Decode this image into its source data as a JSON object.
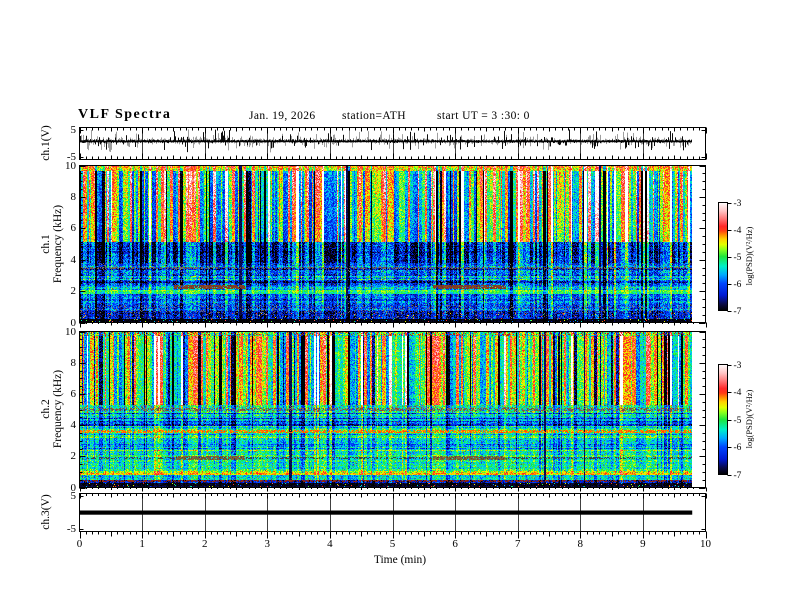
{
  "header": {
    "title": "VLF  Spectra",
    "date": "Jan. 19, 2026",
    "station": "station=ATH",
    "start_ut": "start UT =  3 :30: 0"
  },
  "axes": {
    "x": {
      "label": "Time  (min)",
      "min": 0,
      "max": 10,
      "major_ticks": [
        0,
        1,
        2,
        3,
        4,
        5,
        6,
        7,
        8,
        9,
        10
      ],
      "minor_step": 0.1,
      "data_end_min": 9.78
    },
    "y_labels": {
      "ch1_wf": "ch.1(V)",
      "ch1_spec": [
        "ch.1",
        "Frequency  (kHz)"
      ],
      "ch2_spec": [
        "ch.2",
        "Frequency  (kHz)"
      ],
      "ch3_wf": "ch.3(V)"
    },
    "volt_ticks": [
      5,
      -5
    ],
    "freq_ticks": [
      0,
      2,
      4,
      6,
      8,
      10
    ]
  },
  "colorbar": {
    "label": "log(PSD)(V²/Hz)",
    "ticks": [
      -3,
      -4,
      -5,
      -6,
      -7
    ],
    "range": [
      -7,
      -3
    ]
  },
  "chart_data": {
    "type": "heatmap",
    "title": "VLF Spectra",
    "annotations": [
      "Jan. 19, 2026",
      "station=ATH",
      "start UT =  3 :30: 0"
    ],
    "x": {
      "label": "Time (min)",
      "range": [
        0,
        10
      ],
      "ticks": [
        0,
        1,
        2,
        3,
        4,
        5,
        6,
        7,
        8,
        9,
        10
      ],
      "data_extent": [
        0,
        9.78
      ]
    },
    "colorbar": {
      "label": "log(PSD)(V²/Hz)",
      "range": [
        -7,
        -3
      ],
      "ticks": [
        -3,
        -4,
        -5,
        -6,
        -7
      ],
      "colormap_stops": [
        [
          0.0,
          [
            0,
            0,
            0
          ]
        ],
        [
          0.06,
          [
            10,
            10,
            70
          ]
        ],
        [
          0.14,
          [
            0,
            25,
            210
          ]
        ],
        [
          0.25,
          [
            0,
            70,
            255
          ]
        ],
        [
          0.33,
          [
            0,
            170,
            255
          ]
        ],
        [
          0.41,
          [
            0,
            240,
            200
          ]
        ],
        [
          0.5,
          [
            30,
            230,
            60
          ]
        ],
        [
          0.56,
          [
            130,
            255,
            30
          ]
        ],
        [
          0.61,
          [
            225,
            255,
            0
          ]
        ],
        [
          0.66,
          [
            255,
            210,
            0
          ]
        ],
        [
          0.7,
          [
            255,
            140,
            0
          ]
        ],
        [
          0.74,
          [
            255,
            60,
            20
          ]
        ],
        [
          0.78,
          [
            255,
            40,
            40
          ]
        ],
        [
          0.85,
          [
            255,
            120,
            120
          ]
        ],
        [
          0.92,
          [
            255,
            195,
            195
          ]
        ],
        [
          1.0,
          [
            255,
            255,
            255
          ]
        ]
      ]
    },
    "panels": [
      {
        "id": "ch1_waveform",
        "ylabel": "ch.1(V)",
        "ylim": [
          -5,
          5
        ],
        "yticks": [
          5,
          -5
        ],
        "description": "broadband noise around +0.8 V with dense impulsive spikes reaching ±5 V",
        "baseline": 0.8,
        "sigma": 0.5,
        "spike_prob": 0.05,
        "spike_min": 1.2,
        "spike_max": 4.8,
        "seed": 11
      },
      {
        "id": "ch1_spectrogram",
        "ylabel": [
          "ch.1",
          "Frequency (kHz)"
        ],
        "ylim": [
          0,
          10
        ],
        "yticks": [
          0,
          2,
          4,
          6,
          8,
          10
        ],
        "seed": 7,
        "cols": {
          "dropout": 0.004,
          "dark": 0.1,
          "hot": 0.085
        },
        "bands": [
          {
            "f": [
              9.7,
              10
            ],
            "base": -4.3,
            "col": 0.5,
            "row": 0.2,
            "noise": 0.5
          },
          {
            "f": [
              5.15,
              9.7
            ],
            "base": -5.05,
            "col": 1.35,
            "row": 0.12,
            "noise": 0.45,
            "boost": 0.5,
            "tilt": 0.3
          },
          {
            "f": [
              3.8,
              5.15
            ],
            "base": -6.2,
            "col": 0.85,
            "row": 0.3,
            "noise": 0.55
          },
          {
            "f": [
              3.55,
              3.8
            ],
            "base": -5.6,
            "col": 0.5,
            "row": 0.5,
            "noise": 0.5,
            "grey": 0.05
          },
          {
            "f": [
              2.4,
              3.55
            ],
            "base": -5.95,
            "col": 0.5,
            "row": 0.65,
            "noise": 0.55,
            "grey": 0.03
          },
          {
            "f": [
              2.1,
              2.4
            ],
            "base": -5.55,
            "col": 0.4,
            "row": 0.5,
            "noise": 0.45,
            "grey": 0.04
          },
          {
            "f": [
              1.85,
              2.1
            ],
            "base": -4.85,
            "col": 0.3,
            "row": 0.3,
            "noise": 0.35
          },
          {
            "f": [
              1.15,
              1.85
            ],
            "base": -5.8,
            "col": 0.45,
            "row": 0.7,
            "noise": 0.5,
            "grey": 0.02
          },
          {
            "f": [
              0.6,
              1.15
            ],
            "base": -5.9,
            "col": 0.4,
            "row": 0.6,
            "noise": 0.5,
            "grey": 0.12
          },
          {
            "f": [
              0.25,
              0.6
            ],
            "base": -6.5,
            "col": 0.35,
            "row": 0.5,
            "noise": 0.45,
            "grey": 0.04,
            "speckle": {
              "prob": 0.05
            }
          },
          {
            "f": [
              0,
              0.25
            ],
            "base": -6.95,
            "col": 0.05,
            "row": 0.1,
            "noise": 0.12,
            "speckle": {
              "prob": 0.07
            }
          }
        ],
        "stripes": [
          {
            "f": [
              3.42,
              3.55
            ],
            "x": [
              0,
              9.78
            ],
            "prob": 0.45,
            "rgb": [
              130,
              120,
              110
            ],
            "rgb2": [
              90,
              80,
              70
            ]
          },
          {
            "f": [
              2.12,
              2.38
            ],
            "x": [
              1.49,
              2.62
            ],
            "prob": 0.85,
            "rgb": [
              150,
              75,
              35
            ],
            "rgb2": [
              110,
              50,
              40
            ]
          },
          {
            "f": [
              2.12,
              2.38
            ],
            "x": [
              5.63,
              6.8
            ],
            "prob": 0.85,
            "rgb": [
              150,
              75,
              35
            ],
            "rgb2": [
              110,
              50,
              40
            ]
          }
        ],
        "notable_features": "green background 5-10 kHz with strong vertical streaks (yellow/red tips near top, dark dropouts); deep blue band 3.8-5.1 kHz; horizontally-striped blue/cyan 0.6-3.8 kHz; bright green line ~2 kHz; brown PLHR-like stripe ~2.2 kHz at 1.5-2.6 min and 5.6-6.8 min; black band below 0.25 kHz"
      },
      {
        "id": "ch2_spectrogram",
        "ylabel": [
          "ch.2",
          "Frequency (kHz)"
        ],
        "ylim": [
          0,
          10
        ],
        "yticks": [
          0,
          2,
          4,
          6,
          8,
          10
        ],
        "seed": 13,
        "cols": {
          "dropout": 0.008,
          "dark": 0.13,
          "hot": 0.06
        },
        "bands": [
          {
            "f": [
              9.75,
              10
            ],
            "base": -5.0,
            "col": 0.7,
            "row": 0.2,
            "noise": 0.6,
            "speckle": {
              "prob": 0.15,
              "rgb": [
                170,
                35,
                25
              ]
            }
          },
          {
            "f": [
              5.3,
              9.75
            ],
            "base": -4.92,
            "col": 1.15,
            "row": 0.12,
            "noise": 0.45,
            "boost": 0.25,
            "tilt": 0.1
          },
          {
            "f": [
              4.85,
              5.3
            ],
            "base": -5.25,
            "col": 0.4,
            "row": 0.5,
            "noise": 0.45,
            "grey": 0.14
          },
          {
            "f": [
              4.0,
              4.85
            ],
            "base": -5.6,
            "col": 0.35,
            "row": 0.85,
            "noise": 0.5,
            "grey": 0.02
          },
          {
            "f": [
              3.75,
              4.0
            ],
            "base": -5.15,
            "col": 0.35,
            "row": 0.5,
            "noise": 0.45
          },
          {
            "f": [
              3.45,
              3.75
            ],
            "base": -4.95,
            "col": 0.3,
            "row": 0.4,
            "noise": 0.5
          },
          {
            "f": [
              2.1,
              3.45
            ],
            "base": -5.3,
            "col": 0.35,
            "row": 0.6,
            "noise": 0.45,
            "grey": 0.02
          },
          {
            "f": [
              1.75,
              2.1
            ],
            "base": -5.35,
            "col": 0.3,
            "row": 0.5,
            "noise": 0.4,
            "grey": 0.03
          },
          {
            "f": [
              0.95,
              1.75
            ],
            "base": -5.15,
            "col": 0.3,
            "row": 0.55,
            "noise": 0.45,
            "grey": 0.02
          },
          {
            "f": [
              0.78,
              0.95
            ],
            "base": -4.35,
            "col": 0.2,
            "row": 0.25,
            "noise": 0.35
          },
          {
            "f": [
              0.5,
              0.78
            ],
            "base": -5.5,
            "col": 0.3,
            "row": 0.5,
            "noise": 0.45,
            "grey": 0.03
          },
          {
            "f": [
              0.28,
              0.5
            ],
            "base": -6.4,
            "col": 0.3,
            "row": 0.4,
            "noise": 0.4
          },
          {
            "f": [
              0,
              0.28
            ],
            "base": -6.9,
            "col": 0.05,
            "row": 0.1,
            "noise": 0.15,
            "speckle": {
              "prob": 0.06
            }
          }
        ],
        "stripes": [
          {
            "f": [
              3.5,
              3.72
            ],
            "x": [
              0,
              9.78
            ],
            "prob": 0.55,
            "rgb": [
              255,
              70,
              0
            ],
            "rgb2": [
              255,
              150,
              0
            ]
          },
          {
            "f": [
              4.95,
              5.1
            ],
            "x": [
              0,
              9.78
            ],
            "prob": 0.4,
            "rgb": [
              120,
              110,
              100
            ],
            "rgb2": [
              140,
              60,
              40
            ]
          },
          {
            "f": [
              1.82,
              1.95
            ],
            "x": [
              0,
              9.78
            ],
            "prob": 0.4,
            "rgb": [
              80,
              75,
              60
            ],
            "rgb2": [
              60,
              60,
              60
            ]
          },
          {
            "f": [
              1.78,
              2.02
            ],
            "x": [
              1.49,
              2.62
            ],
            "prob": 0.8,
            "rgb": [
              140,
              110,
              60
            ],
            "rgb2": [
              100,
              80,
              50
            ]
          },
          {
            "f": [
              1.78,
              2.02
            ],
            "x": [
              5.63,
              6.8
            ],
            "prob": 0.8,
            "rgb": [
              140,
              110,
              60
            ],
            "rgb2": [
              100,
              80,
              50
            ]
          },
          {
            "f": [
              0.38,
              0.47
            ],
            "x": [
              0,
              9.78
            ],
            "prob": 0.55,
            "rgb": [
              160,
              45,
              20
            ],
            "rgb2": [
              120,
              30,
              20
            ]
          }
        ],
        "notable_features": "green background with dark vertical dropout streaks 5-10 kHz; grey-brown line ~5 kHz; blue speckled rows 4-4.8 kHz; red-orange dashed stripe ~3.6 kHz; brown stripe ~1.9 kHz at 1.5-2.6 and 5.6-6.8 min; yellow stripe ~0.85 kHz; dark-red line ~0.4 kHz; black band below 0.28 kHz"
      },
      {
        "id": "ch3_waveform",
        "ylabel": "ch.3(V)",
        "ylim": [
          -5,
          5
        ],
        "yticks": [
          5,
          -5
        ],
        "description": "constant flat trace at 0 V for the full record (thick black line, 0 to 9.78 min)",
        "value": 0
      }
    ]
  }
}
